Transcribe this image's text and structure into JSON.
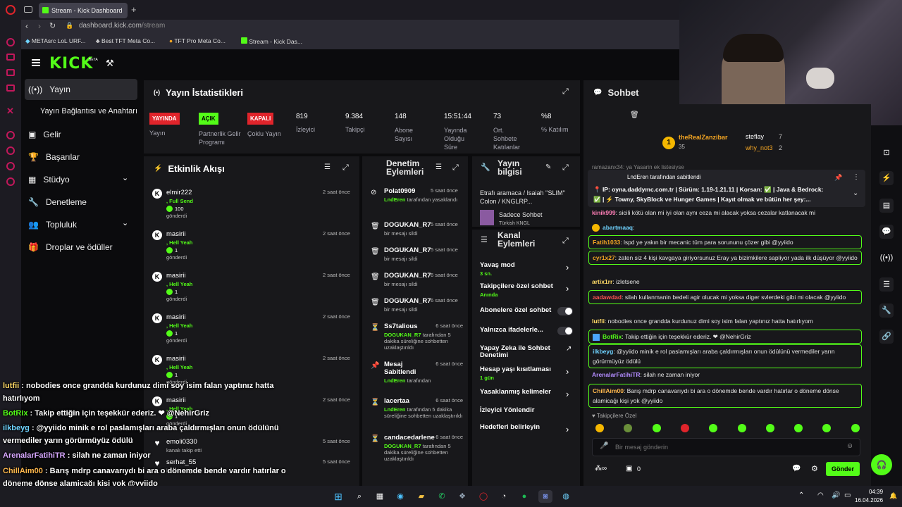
{
  "browser": {
    "tab_title": "Stream - Kick Dashboard",
    "url_host": "dashboard.kick.com",
    "url_path": "/stream",
    "bookmarks": [
      "METAsrc LoL URF...",
      "Best TFT Meta Co...",
      "TFT Pro Meta Co...",
      "Stream - Kick Das..."
    ]
  },
  "brand": {
    "logo": "KICK",
    "beta": "BETA"
  },
  "sidebar": {
    "items": [
      {
        "label": "Yayın",
        "icon": "broadcast-icon"
      },
      {
        "label": "Yayın Bağlantısı ve Anahtarı"
      },
      {
        "label": "Gelir",
        "icon": "money-icon"
      },
      {
        "label": "Başarılar",
        "icon": "trophy-icon"
      },
      {
        "label": "Stüdyo",
        "icon": "grid-icon"
      },
      {
        "label": "Denetleme",
        "icon": "wrench-icon"
      },
      {
        "label": "Topluluk",
        "icon": "people-icon"
      },
      {
        "label": "Droplar ve ödüller",
        "icon": "gift-icon"
      }
    ]
  },
  "stats": {
    "title": "Yayın İstatistikleri",
    "items": [
      {
        "badge": "YAYINDA",
        "label": "Yayın",
        "kind": "red"
      },
      {
        "badge": "AÇIK",
        "label": "Partnerlik Gelir Programı",
        "kind": "green"
      },
      {
        "badge": "KAPALI",
        "label": "Çoklu Yayın",
        "kind": "red"
      },
      {
        "value": "819",
        "label": "İzleyici"
      },
      {
        "value": "9.384",
        "label": "Takipçi"
      },
      {
        "value": "148",
        "label": "Abone Sayısı"
      },
      {
        "value": "15:51:44",
        "label": "Yayında Olduğu Süre"
      },
      {
        "value": "73",
        "label": "Ort. Sohbete Katılanlar"
      },
      {
        "value": "%8",
        "label": "% Katılım"
      }
    ]
  },
  "activity": {
    "title": "Etkinlik Akışı",
    "items": [
      {
        "user": "elmir222",
        "sub": ", Full Send",
        "amount": "100",
        "tail": "gönderdi",
        "time": "2 saat önce"
      },
      {
        "user": "masirii",
        "sub": ", Hell Yeah",
        "amount": "1",
        "tail": "gönderdi",
        "time": "2 saat önce"
      },
      {
        "user": "masirii",
        "sub": ", Hell Yeah",
        "amount": "1",
        "tail": "gönderdi",
        "time": "2 saat önce"
      },
      {
        "user": "masirii",
        "sub": ", Hell Yeah",
        "amount": "1",
        "tail": "gönderdi",
        "time": "2 saat önce"
      },
      {
        "user": "masirii",
        "sub": ", Hell Yeah",
        "amount": "1",
        "tail": "gönderdi",
        "time": "2 saat önce"
      },
      {
        "user": "masirii",
        "sub": ", Hell Yeah",
        "amount": "1",
        "tail": "gönderdi",
        "time": "2 saat önce"
      },
      {
        "user": "emoli0330",
        "sub": "kanalı takip etti",
        "time": "5 saat önce"
      },
      {
        "user": "serhat_55",
        "sub": "kanalı takip etti",
        "time": "5 saat önce"
      }
    ]
  },
  "moderation": {
    "title": "Denetim Eylemleri",
    "items": [
      {
        "user": "Polat0909",
        "time": "5 saat önce",
        "by": "LndEren",
        "desc": "tarafından yasaklandı"
      },
      {
        "user": "DOGUKAN_R7",
        "time": "5 saat önce",
        "desc": "bir mesajı sildi"
      },
      {
        "user": "DOGUKAN_R7",
        "time": "5 saat önce",
        "desc": "bir mesajı sildi"
      },
      {
        "user": "DOGUKAN_R7",
        "time": "6 saat önce",
        "desc": "bir mesajı sildi"
      },
      {
        "user": "DOGUKAN_R7",
        "time": "6 saat önce",
        "desc": "bir mesajı sildi"
      },
      {
        "user": "Ss7talious",
        "time": "6 saat önce",
        "by": "DOGUKAN_R7",
        "desc": "tarafından 5 dakika süreliğine sohbetten uzaklaştırıldı"
      },
      {
        "user": "Mesaj Sabitlendi",
        "time": "6 saat önce",
        "by": "LndEren",
        "desc": "tarafından"
      },
      {
        "user": "lacertaa",
        "time": "6 saat önce",
        "by": "LndEren",
        "desc": "tarafından 5 dakika süreliğine sohbetten uzaklaştırıldı"
      },
      {
        "user": "candacedarlene",
        "time": "6 saat önce",
        "by": "DOGUKAN_R7",
        "desc": "tarafından 5 dakika süreliğine sohbetten uzaklaştırıldı"
      }
    ]
  },
  "stream_info": {
    "title": "Yayın bilgisi",
    "stream_title": "Etrafı aramaca / Isaiah ''SLIM'' Colon / KNGLRP...",
    "mode": "Sadece Sohbet",
    "tags": "Türkish   KNGL"
  },
  "channel_actions": {
    "title": "Kanal Eylemleri",
    "items": [
      {
        "label": "Yavaş mod",
        "sub": "3 sn.",
        "control": "chevron"
      },
      {
        "label": "Takipçilere özel sohbet",
        "sub": "Anında",
        "control": "chevron"
      },
      {
        "label": "Abonelere özel sohbet",
        "control": "toggle"
      },
      {
        "label": "Yalnızca ifadelerle...",
        "control": "toggle"
      },
      {
        "label": "Yapay Zeka ile Sohbet Denetimi",
        "control": "external"
      },
      {
        "label": "Hesap yaşı kısıtlaması",
        "sub": "1 gün",
        "control": "chevron"
      },
      {
        "label": "Yasaklanmış kelimeler",
        "control": "chevron"
      },
      {
        "label": "İzleyici Yönlendir",
        "control": "none"
      },
      {
        "label": "Hedefleri belirleyin",
        "control": "chevron"
      }
    ]
  },
  "chat": {
    "title": "Sohbet",
    "leaders": [
      {
        "rank": "1",
        "name": "theRealZanzibar",
        "count": "35"
      },
      {
        "name": "steflay",
        "count": "7"
      },
      {
        "name": "why_not3",
        "count": "2"
      }
    ],
    "cut_line": "ramazanx34: ya Yasarin ek listesiyse",
    "pinned_by": "LndEren tarafından sabitlendi",
    "pinned_text_1": "📍 IP: oyna.daddymc.com.tr | Sürüm: 1.19-1.21.11 | Korsan: ✅ | Java & Bedrock:",
    "pinned_text_2": "✅ | ⚡ Towny, SkyBlock ve Hunger Games | Kayıt olmak ve bütün her şey:...",
    "messages": [
      {
        "user": "kinik999",
        "text": ": sicili kötü olan mi iyi olan aynı ceza mi alacak yoksa cezalar katlanacak mi",
        "color": "#ff7eb6"
      },
      {
        "user": "abartmaaq",
        "text": ":",
        "color": "#6fd3ff"
      },
      {
        "user": "Fatih1033",
        "text": ": lspd ye yakın bir mecanic tüm para sorununu çözer gibi @yyiido",
        "color": "#f5a623",
        "boxed": true
      },
      {
        "user": "cyr1x27",
        "text": ": zaten siz 4 kişi kavgaya giriyorsunuz Eray ya bizimkilere sapliyor yada ilk düşüyor @yyiido",
        "color": "#f5a623",
        "boxed": true
      },
      {
        "user": "artix1rr",
        "text": ": izletsene",
        "color": "#ffd966"
      },
      {
        "user": "aadawdad",
        "text": ": silah kullanmanin bedeli agir olucak mi yoksa diger svlerdeki gibi mi olacak @yyiido",
        "color": "#ff5252",
        "boxed": true
      },
      {
        "user": "lutfii",
        "text": ": nobodies once grandda kurdunuz dimi soy isim falan yaptınız hatta hatırlıyom",
        "color": "#ffd966"
      },
      {
        "user": "BotRix",
        "text": ": Takip ettiğin için teşekkür ederiz. ❤ @NehirGriz",
        "color": "#53fc18",
        "boxed": true
      },
      {
        "user": "ilkbeyg",
        "text": ": @yyiido minik e rol paslamışları araba çaldırmışları onun ödülünü vermediler yarın görürmüyüz ödülü",
        "color": "#6fd3ff",
        "boxed": true
      },
      {
        "user": "ArenalarFatihiTR",
        "text": ": silah ne zaman iniyor",
        "color": "#b38cff"
      },
      {
        "user": "ChillAim00",
        "text": ": Barış mdrp canavarıydı bi ara o dönemde bende vardır hatırlar o döneme dönse alamicağı kişi yok @yyiido",
        "color": "#ffb84d",
        "boxed": true
      }
    ],
    "emote_label": "Takipçilere Özel",
    "input_placeholder": "Bir mesaj gönderin",
    "points": "0",
    "send_label": "Gönder"
  },
  "overlay": {
    "lines": [
      {
        "user": "lutfii",
        "text": " : nobodies once grandda kurdunuz dimi soy isim falan yaptınız hatta"
      },
      {
        "user": "",
        "text": "hatırlıyom"
      },
      {
        "user": "BotRix",
        "text": " : Takip ettiğin için teşekkür ederiz. ❤ @NehirGriz"
      },
      {
        "user": "ilkbeyg",
        "text": " : @yyiido minik e rol paslamışları araba çaldırmışları onun ödülünü"
      },
      {
        "user": "",
        "text": "vermediler yarın görürmüyüz ödülü"
      },
      {
        "user": "ArenalarFatihiTR",
        "text": " : silah ne zaman iniyor"
      },
      {
        "user": "ChillAim00",
        "text": " : Barış mdrp canavarıydı bi ara o dönemde bende vardır hatırlar o"
      },
      {
        "user": "",
        "text": "döneme dönse alamicağı kişi yok @yyiido"
      }
    ]
  },
  "taskbar": {
    "time": "04:39",
    "date": "16.04.2026"
  }
}
